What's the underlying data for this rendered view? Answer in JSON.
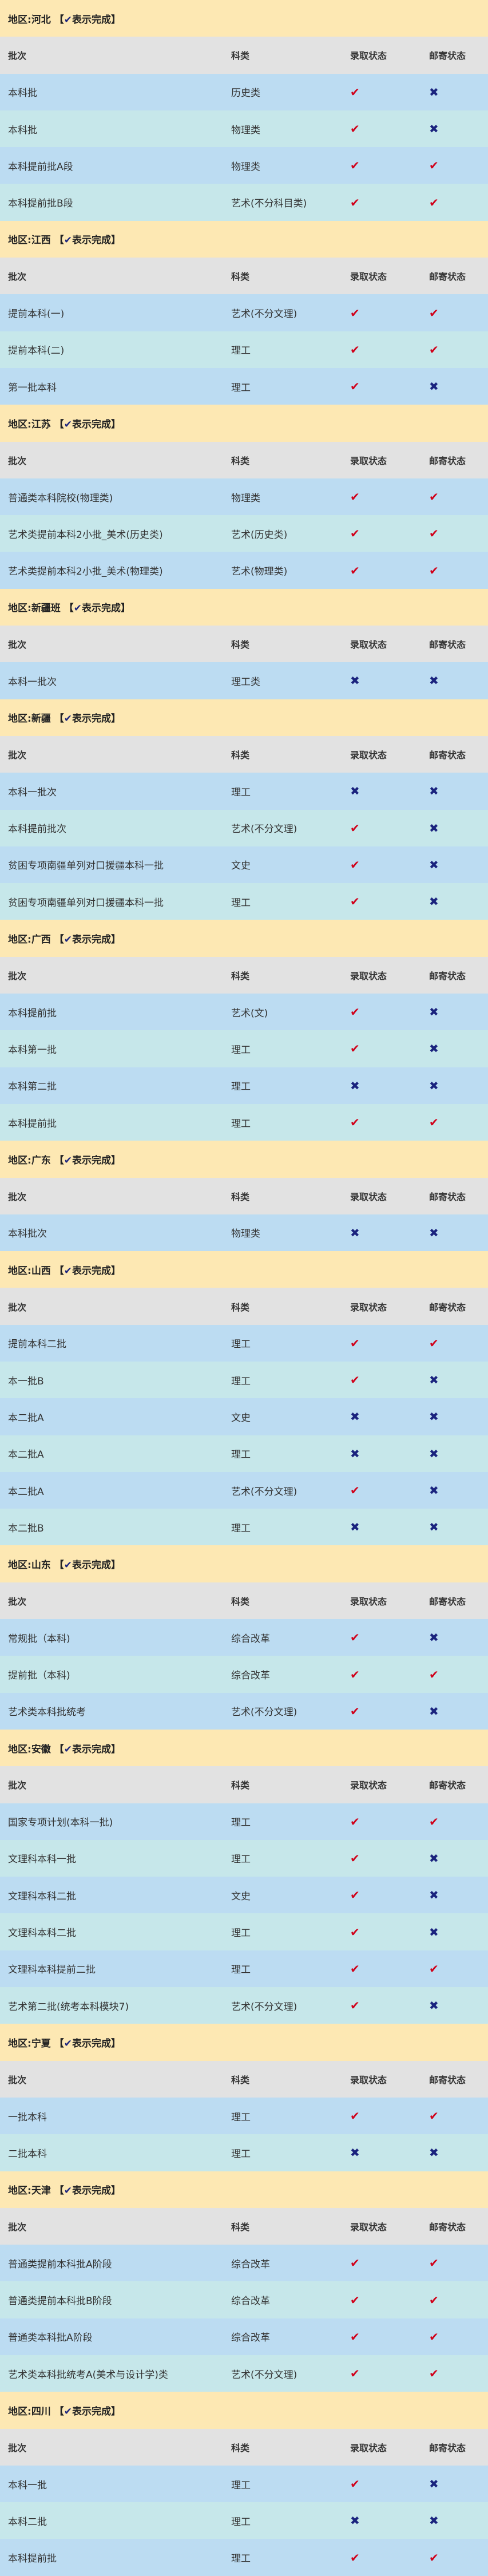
{
  "labels": {
    "region_prefix": "地区: ",
    "legend": "【✔表示完成】",
    "check_glyph": "✔",
    "cross_glyph": "✖"
  },
  "columns": {
    "batch": "批次",
    "subject": "科类",
    "admission": "录取状态",
    "mail": "邮寄状态"
  },
  "colors": {
    "region_bg": "#fde8b3",
    "header_bg": "#e2e2e2",
    "row_blue": "#bcdcf2",
    "row_teal": "#c6e7ea",
    "check": "#d0021b",
    "cross": "#1a237e"
  },
  "regions": [
    {
      "name": "河北",
      "rows": [
        {
          "batch": "本科批",
          "subject": "历史类",
          "admitted": true,
          "mailed": false
        },
        {
          "batch": "本科批",
          "subject": "物理类",
          "admitted": true,
          "mailed": false
        },
        {
          "batch": "本科提前批A段",
          "subject": "物理类",
          "admitted": true,
          "mailed": true
        },
        {
          "batch": "本科提前批B段",
          "subject": "艺术(不分科目类)",
          "admitted": true,
          "mailed": true
        }
      ]
    },
    {
      "name": "江西",
      "rows": [
        {
          "batch": "提前本科(一)",
          "subject": "艺术(不分文理)",
          "admitted": true,
          "mailed": true
        },
        {
          "batch": "提前本科(二)",
          "subject": "理工",
          "admitted": true,
          "mailed": true
        },
        {
          "batch": "第一批本科",
          "subject": "理工",
          "admitted": true,
          "mailed": false
        }
      ]
    },
    {
      "name": "江苏",
      "rows": [
        {
          "batch": "普通类本科院校(物理类)",
          "subject": "物理类",
          "admitted": true,
          "mailed": true
        },
        {
          "batch": "艺术类提前本科2小批_美术(历史类)",
          "subject": "艺术(历史类)",
          "admitted": true,
          "mailed": true
        },
        {
          "batch": "艺术类提前本科2小批_美术(物理类)",
          "subject": "艺术(物理类)",
          "admitted": true,
          "mailed": true
        }
      ]
    },
    {
      "name": "新疆班",
      "rows": [
        {
          "batch": "本科一批次",
          "subject": "理工类",
          "admitted": false,
          "mailed": false
        }
      ]
    },
    {
      "name": "新疆",
      "rows": [
        {
          "batch": "本科一批次",
          "subject": "理工",
          "admitted": false,
          "mailed": false
        },
        {
          "batch": "本科提前批次",
          "subject": "艺术(不分文理)",
          "admitted": true,
          "mailed": false
        },
        {
          "batch": "贫困专项南疆单列对口援疆本科一批",
          "subject": "文史",
          "admitted": true,
          "mailed": false
        },
        {
          "batch": "贫困专项南疆单列对口援疆本科一批",
          "subject": "理工",
          "admitted": true,
          "mailed": false
        }
      ]
    },
    {
      "name": "广西",
      "rows": [
        {
          "batch": "本科提前批",
          "subject": "艺术(文)",
          "admitted": true,
          "mailed": false
        },
        {
          "batch": "本科第一批",
          "subject": "理工",
          "admitted": true,
          "mailed": false
        },
        {
          "batch": "本科第二批",
          "subject": "理工",
          "admitted": false,
          "mailed": false
        },
        {
          "batch": "本科提前批",
          "subject": "理工",
          "admitted": true,
          "mailed": true
        }
      ]
    },
    {
      "name": "广东",
      "rows": [
        {
          "batch": "本科批次",
          "subject": "物理类",
          "admitted": false,
          "mailed": false
        }
      ]
    },
    {
      "name": "山西",
      "rows": [
        {
          "batch": "提前本科二批",
          "subject": "理工",
          "admitted": true,
          "mailed": true
        },
        {
          "batch": "本一批B",
          "subject": "理工",
          "admitted": true,
          "mailed": false
        },
        {
          "batch": "本二批A",
          "subject": "文史",
          "admitted": false,
          "mailed": false
        },
        {
          "batch": "本二批A",
          "subject": "理工",
          "admitted": false,
          "mailed": false
        },
        {
          "batch": "本二批A",
          "subject": "艺术(不分文理)",
          "admitted": true,
          "mailed": false
        },
        {
          "batch": "本二批B",
          "subject": "理工",
          "admitted": false,
          "mailed": false
        }
      ]
    },
    {
      "name": "山东",
      "rows": [
        {
          "batch": "常规批（本科)",
          "subject": "综合改革",
          "admitted": true,
          "mailed": false
        },
        {
          "batch": "提前批（本科)",
          "subject": "综合改革",
          "admitted": true,
          "mailed": true
        },
        {
          "batch": "艺术类本科批统考",
          "subject": "艺术(不分文理)",
          "admitted": true,
          "mailed": false
        }
      ]
    },
    {
      "name": "安徽",
      "rows": [
        {
          "batch": "国家专项计划(本科一批)",
          "subject": "理工",
          "admitted": true,
          "mailed": true
        },
        {
          "batch": "文理科本科一批",
          "subject": "理工",
          "admitted": true,
          "mailed": false
        },
        {
          "batch": "文理科本科二批",
          "subject": "文史",
          "admitted": true,
          "mailed": false
        },
        {
          "batch": "文理科本科二批",
          "subject": "理工",
          "admitted": true,
          "mailed": false
        },
        {
          "batch": "文理科本科提前二批",
          "subject": "理工",
          "admitted": true,
          "mailed": true
        },
        {
          "batch": "艺术第二批(统考本科模块7)",
          "subject": "艺术(不分文理)",
          "admitted": true,
          "mailed": false
        }
      ]
    },
    {
      "name": "宁夏",
      "rows": [
        {
          "batch": "一批本科",
          "subject": "理工",
          "admitted": true,
          "mailed": true
        },
        {
          "batch": "二批本科",
          "subject": "理工",
          "admitted": false,
          "mailed": false
        }
      ]
    },
    {
      "name": "天津",
      "rows": [
        {
          "batch": "普通类提前本科批A阶段",
          "subject": "综合改革",
          "admitted": true,
          "mailed": true
        },
        {
          "batch": "普通类提前本科批B阶段",
          "subject": "综合改革",
          "admitted": true,
          "mailed": true
        },
        {
          "batch": "普通类本科批A阶段",
          "subject": "综合改革",
          "admitted": true,
          "mailed": true
        },
        {
          "batch": "艺术类本科批统考A(美术与设计学)类",
          "subject": "艺术(不分文理)",
          "admitted": true,
          "mailed": true
        }
      ]
    },
    {
      "name": "四川",
      "rows": [
        {
          "batch": "本科一批",
          "subject": "理工",
          "admitted": true,
          "mailed": false
        },
        {
          "batch": "本科二批",
          "subject": "理工",
          "admitted": false,
          "mailed": false
        },
        {
          "batch": "本科提前批",
          "subject": "理工",
          "admitted": true,
          "mailed": true
        }
      ]
    }
  ]
}
